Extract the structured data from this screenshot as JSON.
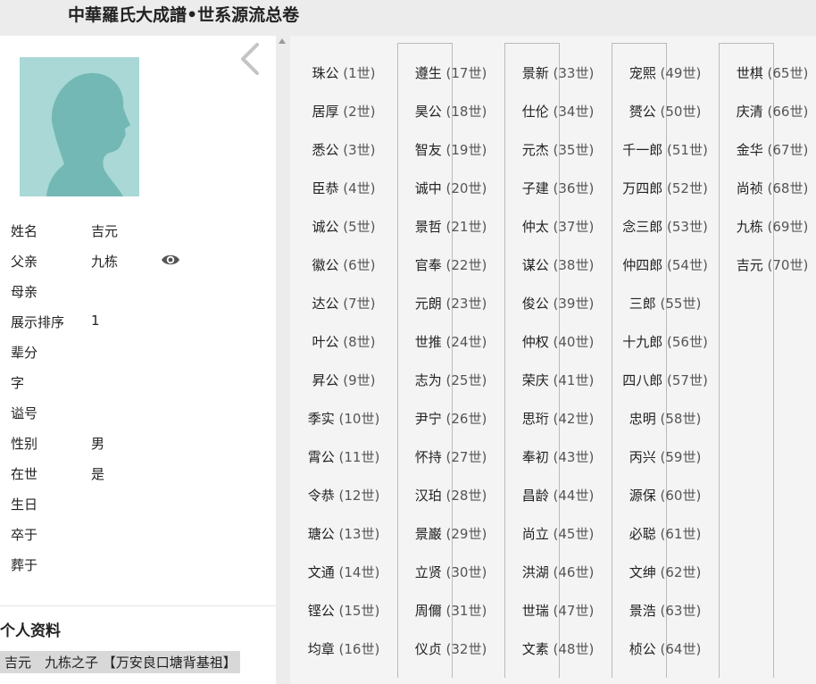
{
  "header": {
    "title": "中華羅氏大成譜•世系源流总卷"
  },
  "profile": {
    "fields": [
      {
        "label": "姓名",
        "value": "吉元"
      },
      {
        "label": "父亲",
        "value": "九栋"
      },
      {
        "label": "母亲",
        "value": ""
      },
      {
        "label": "展示排序",
        "value": "1"
      },
      {
        "label": "辈分",
        "value": ""
      },
      {
        "label": "字",
        "value": ""
      },
      {
        "label": "谥号",
        "value": ""
      },
      {
        "label": "性别",
        "value": "男"
      },
      {
        "label": "在世",
        "value": "是"
      },
      {
        "label": "生日",
        "value": ""
      },
      {
        "label": "卒于",
        "value": ""
      },
      {
        "label": "葬于",
        "value": ""
      }
    ],
    "section_title": "个人资料",
    "note": "吉元　九栋之子 【万安良口塘背基祖】"
  },
  "generations": [
    {
      "name": "珠公",
      "gen": "(1世)"
    },
    {
      "name": "居厚",
      "gen": "(2世)"
    },
    {
      "name": "悉公",
      "gen": "(3世)"
    },
    {
      "name": "臣恭",
      "gen": "(4世)"
    },
    {
      "name": "诚公",
      "gen": "(5世)"
    },
    {
      "name": "徽公",
      "gen": "(6世)"
    },
    {
      "name": "达公",
      "gen": "(7世)"
    },
    {
      "name": "叶公",
      "gen": "(8世)"
    },
    {
      "name": "昇公",
      "gen": "(9世)"
    },
    {
      "name": "季实",
      "gen": "(10世)"
    },
    {
      "name": "霄公",
      "gen": "(11世)"
    },
    {
      "name": "令恭",
      "gen": "(12世)"
    },
    {
      "name": "瑭公",
      "gen": "(13世)"
    },
    {
      "name": "文通",
      "gen": "(14世)"
    },
    {
      "name": "铿公",
      "gen": "(15世)"
    },
    {
      "name": "均章",
      "gen": "(16世)"
    },
    {
      "name": "遵生",
      "gen": "(17世)"
    },
    {
      "name": "昊公",
      "gen": "(18世)"
    },
    {
      "name": "智友",
      "gen": "(19世)"
    },
    {
      "name": "诚中",
      "gen": "(20世)"
    },
    {
      "name": "景哲",
      "gen": "(21世)"
    },
    {
      "name": "官奉",
      "gen": "(22世)"
    },
    {
      "name": "元朗",
      "gen": "(23世)"
    },
    {
      "name": "世推",
      "gen": "(24世)"
    },
    {
      "name": "志为",
      "gen": "(25世)"
    },
    {
      "name": "尹宁",
      "gen": "(26世)"
    },
    {
      "name": "怀持",
      "gen": "(27世)"
    },
    {
      "name": "汉珀",
      "gen": "(28世)"
    },
    {
      "name": "景巌",
      "gen": "(29世)"
    },
    {
      "name": "立贤",
      "gen": "(30世)"
    },
    {
      "name": "周儞",
      "gen": "(31世)"
    },
    {
      "name": "仪贞",
      "gen": "(32世)"
    },
    {
      "name": "景新",
      "gen": "(33世)"
    },
    {
      "name": "仕伦",
      "gen": "(34世)"
    },
    {
      "name": "元杰",
      "gen": "(35世)"
    },
    {
      "name": "子建",
      "gen": "(36世)"
    },
    {
      "name": "仲太",
      "gen": "(37世)"
    },
    {
      "name": "谋公",
      "gen": "(38世)"
    },
    {
      "name": "俊公",
      "gen": "(39世)"
    },
    {
      "name": "仲权",
      "gen": "(40世)"
    },
    {
      "name": "荣庆",
      "gen": "(41世)"
    },
    {
      "name": "思珩",
      "gen": "(42世)"
    },
    {
      "name": "奉初",
      "gen": "(43世)"
    },
    {
      "name": "昌龄",
      "gen": "(44世)"
    },
    {
      "name": "尚立",
      "gen": "(45世)"
    },
    {
      "name": "洪湖",
      "gen": "(46世)"
    },
    {
      "name": "世瑞",
      "gen": "(47世)"
    },
    {
      "name": "文素",
      "gen": "(48世)"
    },
    {
      "name": "宠熙",
      "gen": "(49世)"
    },
    {
      "name": "赟公",
      "gen": "(50世)"
    },
    {
      "name": "千一郎",
      "gen": "(51世)"
    },
    {
      "name": "万四郎",
      "gen": "(52世)"
    },
    {
      "name": "念三郎",
      "gen": "(53世)"
    },
    {
      "name": "仲四郎",
      "gen": "(54世)"
    },
    {
      "name": "三郎",
      "gen": "(55世)"
    },
    {
      "name": "十九郎",
      "gen": "(56世)"
    },
    {
      "name": "四八郎",
      "gen": "(57世)"
    },
    {
      "name": "忠明",
      "gen": "(58世)"
    },
    {
      "name": "丙兴",
      "gen": "(59世)"
    },
    {
      "name": "源保",
      "gen": "(60世)"
    },
    {
      "name": "必聪",
      "gen": "(61世)"
    },
    {
      "name": "文绅",
      "gen": "(62世)"
    },
    {
      "name": "景浩",
      "gen": "(63世)"
    },
    {
      "name": "桢公",
      "gen": "(64世)"
    },
    {
      "name": "世棋",
      "gen": "(65世)"
    },
    {
      "name": "庆清",
      "gen": "(66世)"
    },
    {
      "name": "金华",
      "gen": "(67世)"
    },
    {
      "name": "尚祯",
      "gen": "(68世)"
    },
    {
      "name": "九栋",
      "gen": "(69世)"
    },
    {
      "name": "吉元",
      "gen": "(70世)"
    }
  ]
}
